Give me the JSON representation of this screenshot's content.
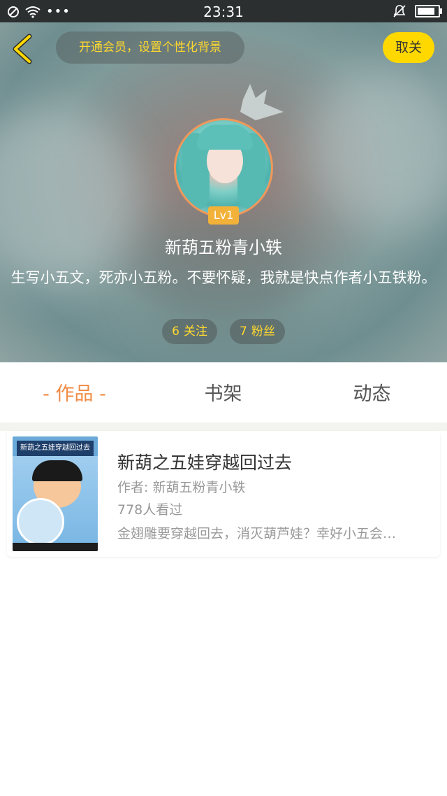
{
  "status_bar": {
    "time": "23:31",
    "icons": [
      "no-sim-icon",
      "wifi-icon",
      "more-dots-icon",
      "mute-bell-icon",
      "battery-icon"
    ],
    "battery_level": 0.85
  },
  "header": {
    "vip_prompt": "开通会员，设置个性化背景",
    "unfollow_label": "取关",
    "level": "Lv1",
    "username": "新葫五粉青小轶",
    "bio": "生写小五文，死亦小五粉。不要怀疑，我就是快点作者小五铁粉。",
    "following": {
      "count": "6",
      "label": "关注"
    },
    "followers": {
      "count": "7",
      "label": "粉丝"
    }
  },
  "tabs": [
    {
      "label": "- 作品 -",
      "active": true
    },
    {
      "label": "书架",
      "active": false
    },
    {
      "label": "动态",
      "active": false
    }
  ],
  "works": [
    {
      "title": "新葫之五娃穿越回过去",
      "author": "作者: 新葫五粉青小轶",
      "views": "778人看过",
      "description": "金翅雕要穿越回去，消灭葫芦娃？幸好小五会…",
      "cover_text": "新葫之五娃穿越回过去"
    }
  ],
  "colors": {
    "accent_orange": "#f08a44",
    "yellow": "#ffd800",
    "gold_text": "#ffd92e"
  }
}
